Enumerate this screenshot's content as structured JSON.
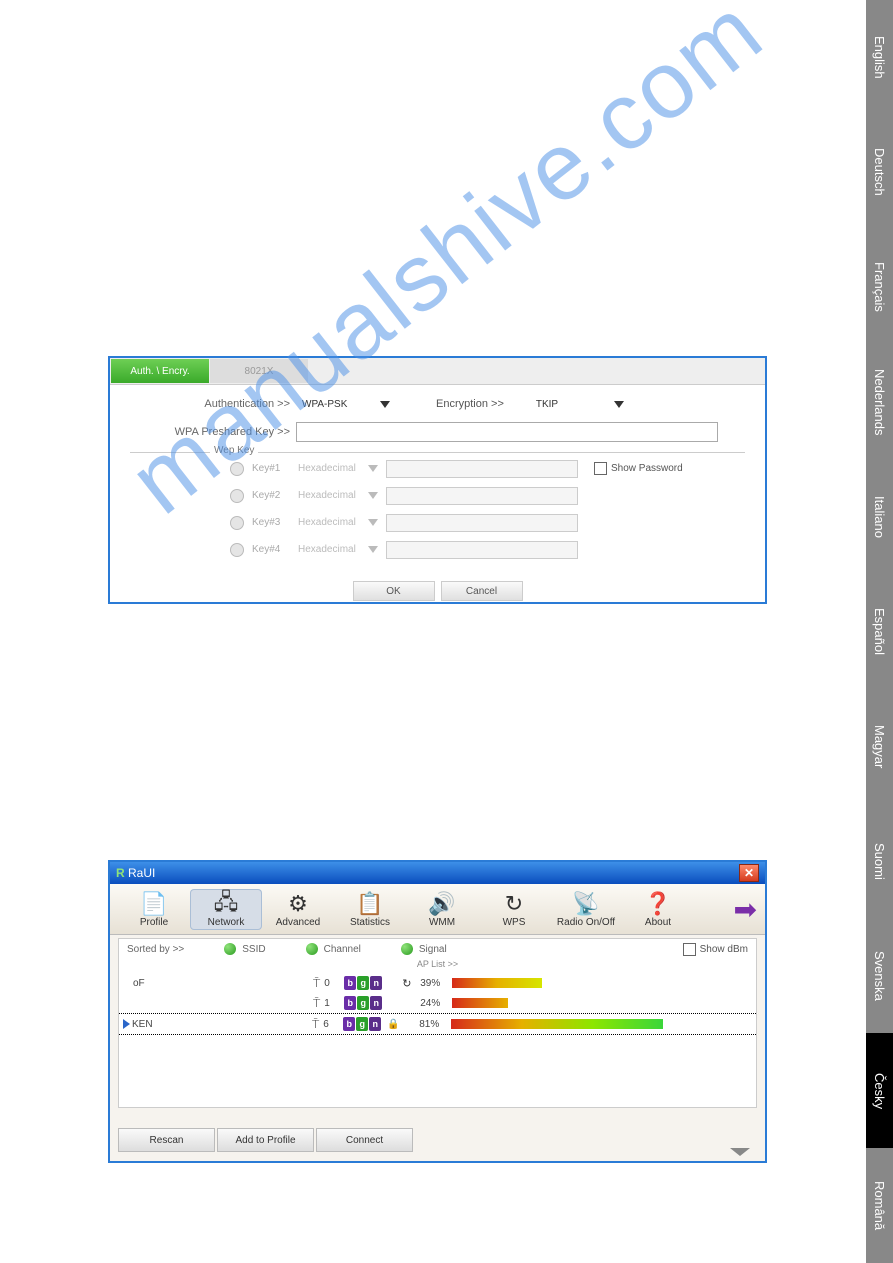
{
  "languages": [
    "English",
    "Deutsch",
    "Français",
    "Nederlands",
    "Italiano",
    "Español",
    "Magyar",
    "Suomi",
    "Svenska",
    "Česky",
    "Română"
  ],
  "active_language_index": 9,
  "watermark": "manualshive.com",
  "panel1": {
    "tabs": {
      "active": "Auth. \\ Encry.",
      "inactive": "8021X"
    },
    "auth_label": "Authentication >>",
    "auth_value": "WPA-PSK",
    "encry_label": "Encryption >>",
    "encry_value": "TKIP",
    "psk_label": "WPA Preshared Key >>",
    "wep_legend": "Wep Key",
    "keys": [
      {
        "label": "Key#1",
        "type": "Hexadecimal"
      },
      {
        "label": "Key#2",
        "type": "Hexadecimal"
      },
      {
        "label": "Key#3",
        "type": "Hexadecimal"
      },
      {
        "label": "Key#4",
        "type": "Hexadecimal"
      }
    ],
    "show_password": "Show Password",
    "ok": "OK",
    "cancel": "Cancel"
  },
  "panel2": {
    "title": "RaUI",
    "title_prefix": "R",
    "toolbar": [
      {
        "label": "Profile",
        "icon": "📄"
      },
      {
        "label": "Network",
        "icon": "🖧",
        "active": true
      },
      {
        "label": "Advanced",
        "icon": "⚙"
      },
      {
        "label": "Statistics",
        "icon": "📋"
      },
      {
        "label": "WMM",
        "icon": "🔊"
      },
      {
        "label": "WPS",
        "icon": "↻"
      },
      {
        "label": "Radio On/Off",
        "icon": "📡"
      },
      {
        "label": "About",
        "icon": "❓"
      }
    ],
    "next_icon": "➡",
    "sort_label": "Sorted by >>",
    "sort_opts": [
      "SSID",
      "Channel",
      "Signal"
    ],
    "show_dbm": "Show dBm",
    "aplist_header": "AP List >>",
    "rows": [
      {
        "name": "oF",
        "ch": "0",
        "bgn": [
          "b",
          "g",
          "n"
        ],
        "lock": false,
        "refresh": true,
        "pct": "39%",
        "sig": "sig39",
        "selected": false
      },
      {
        "name": "",
        "ch": "1",
        "bgn": [
          "b",
          "g",
          "n"
        ],
        "lock": false,
        "refresh": false,
        "pct": "24%",
        "sig": "sig24",
        "selected": false
      },
      {
        "name": "KEN",
        "ch": "6",
        "bgn": [
          "b",
          "g",
          "n"
        ],
        "lock": true,
        "refresh": false,
        "pct": "81%",
        "sig": "sig81",
        "selected": true
      }
    ],
    "buttons": [
      "Rescan",
      "Add to Profile",
      "Connect"
    ]
  }
}
